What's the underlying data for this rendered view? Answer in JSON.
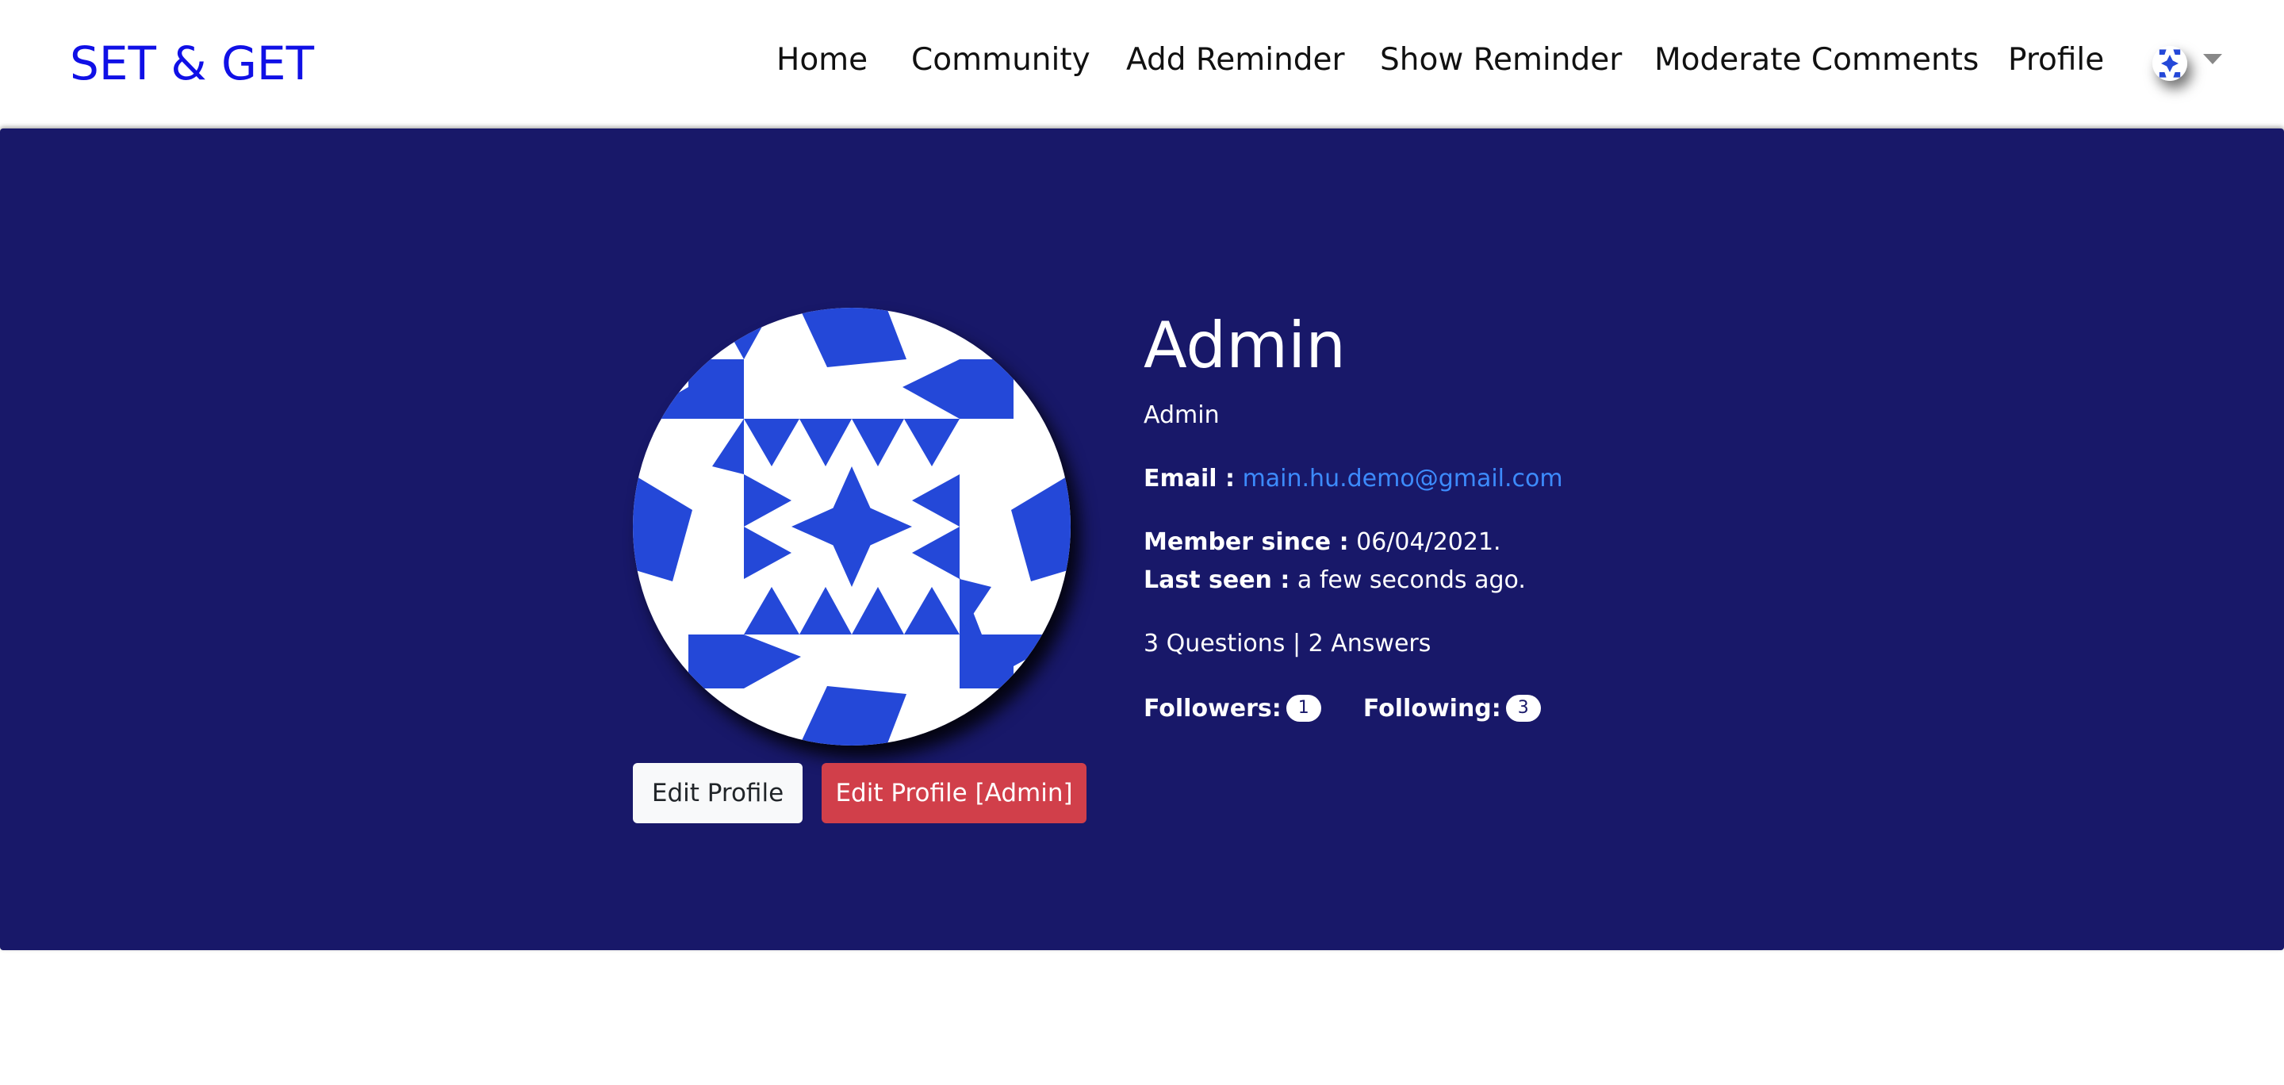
{
  "navbar": {
    "brand": "SET & GET",
    "links": [
      "Home",
      "Community",
      "Add Reminder",
      "Show Reminder",
      "Moderate Comments",
      "Profile"
    ]
  },
  "profile": {
    "username": "Admin",
    "role": "Admin",
    "email_label": "Email :",
    "email": "main.hu.demo@gmail.com",
    "member_since_label": "Member since :",
    "member_since": "06/04/2021.",
    "last_seen_label": "Last seen :",
    "last_seen": "a few seconds ago.",
    "stats": "3 Questions | 2 Answers",
    "followers_label": "Followers:",
    "followers_count": "1",
    "following_label": "Following:",
    "following_count": "3",
    "edit_profile_button": "Edit Profile",
    "edit_profile_admin_button": "Edit Profile [Admin]"
  },
  "colors": {
    "brand": "#1010e6",
    "jumbotron_bg": "#181869",
    "avatar_pattern": "#2448d8",
    "link": "#3d8bfd",
    "danger": "#d13f4a"
  },
  "icons": {
    "avatar": "identicon-avatar",
    "dropdown": "caret-down-icon"
  }
}
